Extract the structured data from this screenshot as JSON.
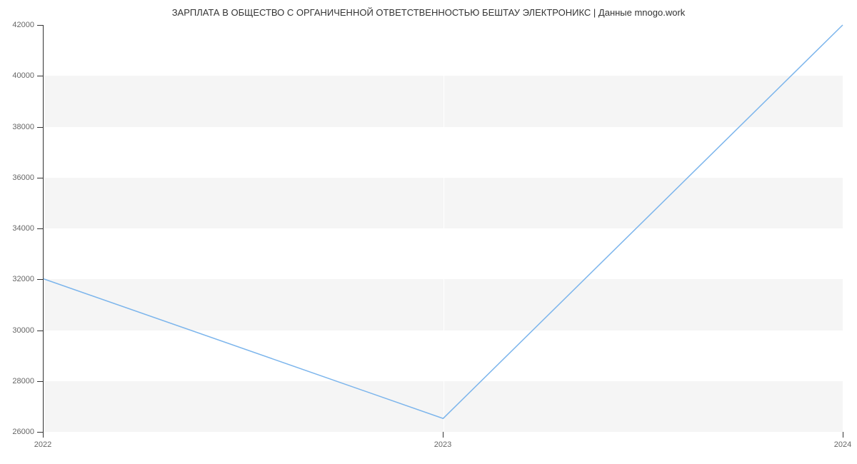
{
  "chart_data": {
    "type": "line",
    "title": "ЗАРПЛАТА В ОБЩЕСТВО С ОРГАНИЧЕННОЙ ОТВЕТСТВЕННОСТЬЮ БЕШТАУ ЭЛЕКТРОНИКС | Данные mnogo.work",
    "x": [
      2022,
      2023,
      2024
    ],
    "values": [
      32000,
      26500,
      42000
    ],
    "xlabel": "",
    "ylabel": "",
    "x_ticks": [
      2022,
      2023,
      2024
    ],
    "y_ticks": [
      26000,
      28000,
      30000,
      32000,
      34000,
      36000,
      38000,
      40000,
      42000
    ],
    "xlim": [
      2022,
      2024
    ],
    "ylim": [
      26000,
      42000
    ],
    "line_color": "#7cb5ec"
  }
}
